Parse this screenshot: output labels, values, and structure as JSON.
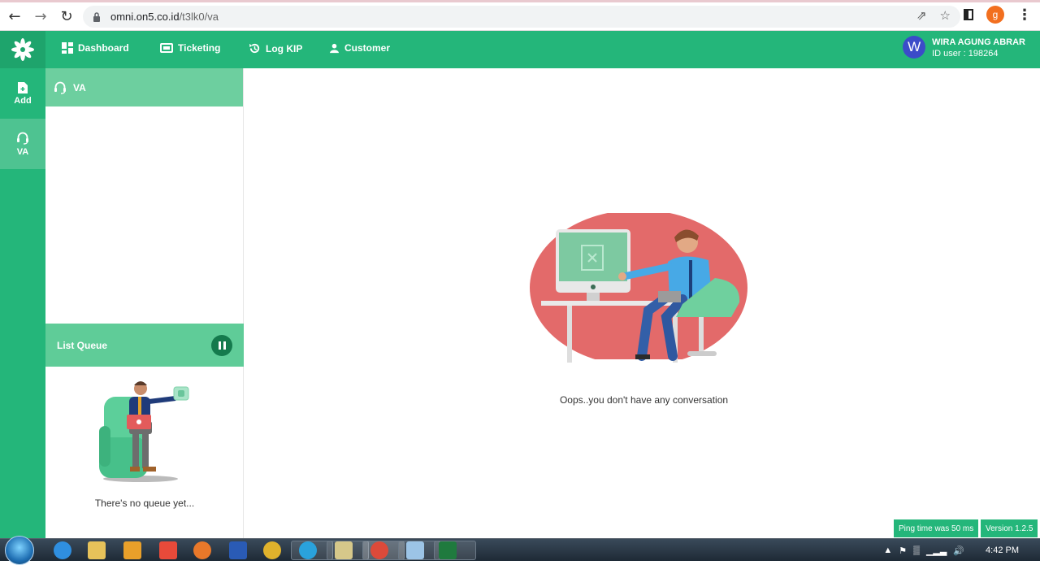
{
  "browser": {
    "url_host": "omni.on5.co.id",
    "url_path": "/t3lk0/va",
    "profile_initial": "g"
  },
  "header": {
    "nav": [
      {
        "label": "Dashboard",
        "icon": "grid-icon"
      },
      {
        "label": "Ticketing",
        "icon": "ticket-icon"
      },
      {
        "label": "Log KIP",
        "icon": "history-icon"
      },
      {
        "label": "Customer",
        "icon": "person-icon"
      }
    ],
    "user": {
      "initial": "W",
      "name": "WIRA AGUNG ABRAR",
      "id_text": "ID user : 198264"
    }
  },
  "rail": {
    "items": [
      {
        "label": "Add",
        "icon": "add-file-icon"
      },
      {
        "label": "VA",
        "icon": "headset-icon"
      }
    ]
  },
  "panel": {
    "title": "VA",
    "queue_title": "List Queue",
    "queue_empty": "There's no queue yet..."
  },
  "main": {
    "empty_message": "Oops..you don't have any conversation"
  },
  "footer": {
    "ping": "Ping time was 50 ms",
    "version": "Version 1.2.5"
  },
  "taskbar": {
    "clock": "4:42 PM"
  },
  "colors": {
    "brand_green": "#24b67a",
    "panel_green": "#6dcf9f",
    "illustration_red": "#e36a6a"
  }
}
